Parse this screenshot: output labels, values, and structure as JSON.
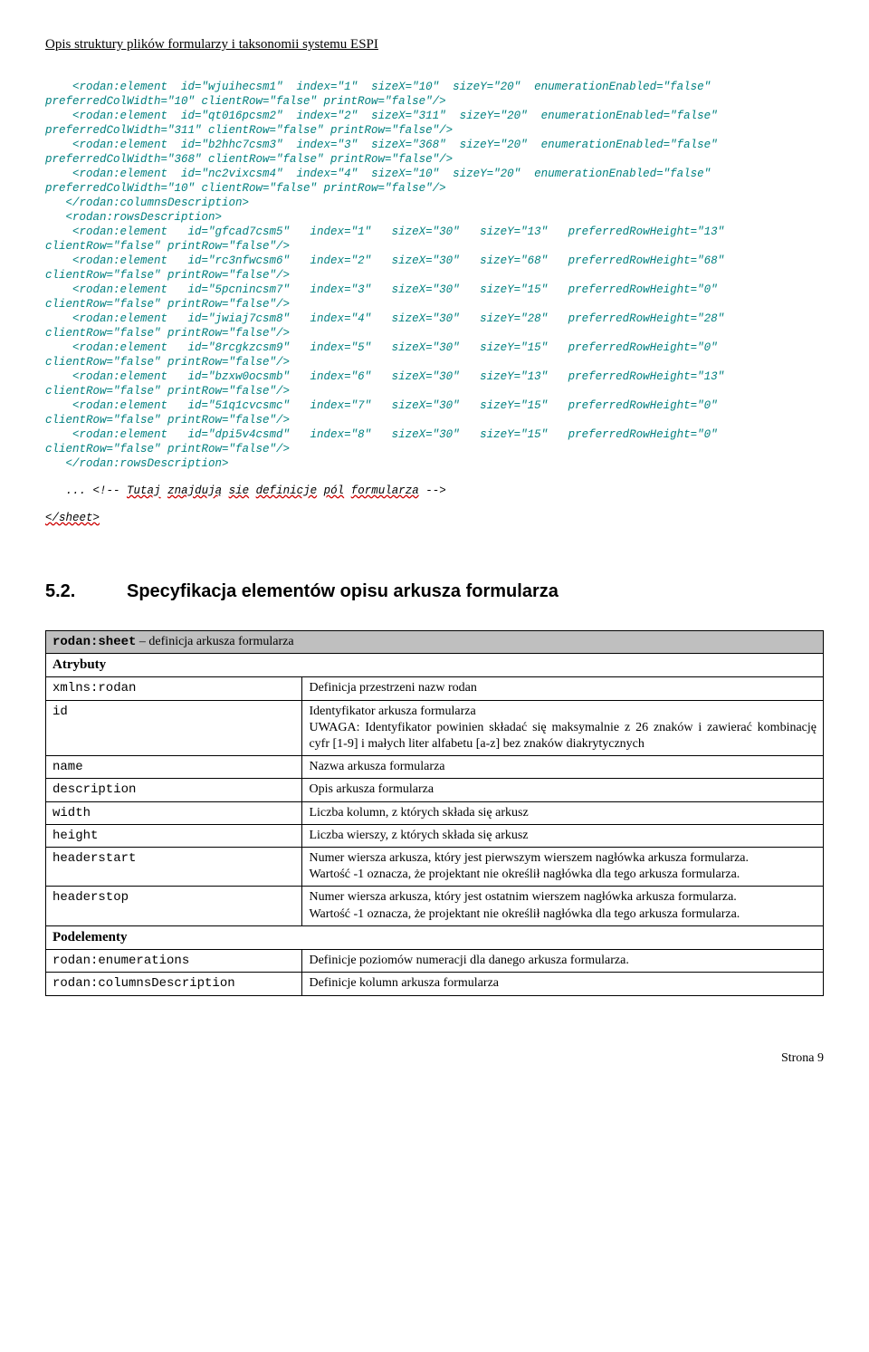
{
  "header": "Opis struktury plików formularzy i taksonomii systemu ESPI",
  "code": "    <rodan:element  id=\"wjuihecsm1\"  index=\"1\"  sizeX=\"10\"  sizeY=\"20\"  enumerationEnabled=\"false\"\npreferredColWidth=\"10\" clientRow=\"false\" printRow=\"false\"/>\n    <rodan:element  id=\"qt016pcsm2\"  index=\"2\"  sizeX=\"311\"  sizeY=\"20\"  enumerationEnabled=\"false\"\npreferredColWidth=\"311\" clientRow=\"false\" printRow=\"false\"/>\n    <rodan:element  id=\"b2hhc7csm3\"  index=\"3\"  sizeX=\"368\"  sizeY=\"20\"  enumerationEnabled=\"false\"\npreferredColWidth=\"368\" clientRow=\"false\" printRow=\"false\"/>\n    <rodan:element  id=\"nc2vixcsm4\"  index=\"4\"  sizeX=\"10\"  sizeY=\"20\"  enumerationEnabled=\"false\"\npreferredColWidth=\"10\" clientRow=\"false\" printRow=\"false\"/>\n   </rodan:columnsDescription>\n   <rodan:rowsDescription>\n    <rodan:element   id=\"gfcad7csm5\"   index=\"1\"   sizeX=\"30\"   sizeY=\"13\"   preferredRowHeight=\"13\"\nclientRow=\"false\" printRow=\"false\"/>\n    <rodan:element   id=\"rc3nfwcsm6\"   index=\"2\"   sizeX=\"30\"   sizeY=\"68\"   preferredRowHeight=\"68\"\nclientRow=\"false\" printRow=\"false\"/>\n    <rodan:element   id=\"5pcnincsm7\"   index=\"3\"   sizeX=\"30\"   sizeY=\"15\"   preferredRowHeight=\"0\"\nclientRow=\"false\" printRow=\"false\"/>\n    <rodan:element   id=\"jwiaj7csm8\"   index=\"4\"   sizeX=\"30\"   sizeY=\"28\"   preferredRowHeight=\"28\"\nclientRow=\"false\" printRow=\"false\"/>\n    <rodan:element   id=\"8rcgkzcsm9\"   index=\"5\"   sizeX=\"30\"   sizeY=\"15\"   preferredRowHeight=\"0\"\nclientRow=\"false\" printRow=\"false\"/>\n    <rodan:element   id=\"bzxw0ocsmb\"   index=\"6\"   sizeX=\"30\"   sizeY=\"13\"   preferredRowHeight=\"13\"\nclientRow=\"false\" printRow=\"false\"/>\n    <rodan:element   id=\"51q1cvcsmc\"   index=\"7\"   sizeX=\"30\"   sizeY=\"15\"   preferredRowHeight=\"0\"\nclientRow=\"false\" printRow=\"false\"/>\n    <rodan:element   id=\"dpi5v4csmd\"   index=\"8\"   sizeX=\"30\"   sizeY=\"15\"   preferredRowHeight=\"0\"\nclientRow=\"false\" printRow=\"false\"/>\n   </rodan:rowsDescription>",
  "comment_prefix": "... <!-- ",
  "comment_words": [
    "Tutaj",
    "znajdują",
    "sie",
    "definicje",
    "pól",
    "formularza"
  ],
  "comment_suffix": " -->",
  "sheet_close": "</sheet>",
  "section": {
    "num": "5.2.",
    "title": "Specyfikacja elementów opisu arkusza formularza"
  },
  "table": {
    "title_code": "rodan:sheet",
    "title_rest": " – definicja arkusza formularza",
    "group_attr": "Atrybuty",
    "group_sub": "Podelementy",
    "rows_attr": [
      {
        "k": "xmlns:rodan",
        "v": "Definicja przestrzeni nazw rodan"
      },
      {
        "k": "id",
        "v": "Identyfikator arkusza formularza\nUWAGA: Identyfikator powinien składać się maksymalnie z 26 znaków i zawierać kombinację cyfr [1-9] i małych liter alfabetu [a-z] bez znaków diakrytycznych"
      },
      {
        "k": "name",
        "v": "Nazwa arkusza formularza"
      },
      {
        "k": "description",
        "v": "Opis arkusza formularza"
      },
      {
        "k": "width",
        "v": "Liczba kolumn, z których składa się arkusz"
      },
      {
        "k": "height",
        "v": "Liczba wierszy, z których składa się arkusz"
      },
      {
        "k": "headerstart",
        "v": "Numer wiersza arkusza, który jest pierwszym wierszem nagłówka arkusza formularza.\nWartość -1 oznacza, że projektant nie określił nagłówka dla tego arkusza formularza."
      },
      {
        "k": "headerstop",
        "v": "Numer wiersza arkusza, który jest ostatnim wierszem nagłówka arkusza formularza.\nWartość -1 oznacza, że projektant nie określił nagłówka dla tego arkusza formularza."
      }
    ],
    "rows_sub": [
      {
        "k": "rodan:enumerations",
        "v": "Definicje poziomów numeracji dla danego arkusza formularza."
      },
      {
        "k": "rodan:columnsDescription",
        "v": "Definicje kolumn arkusza formularza"
      }
    ]
  },
  "page_num": "Strona 9"
}
